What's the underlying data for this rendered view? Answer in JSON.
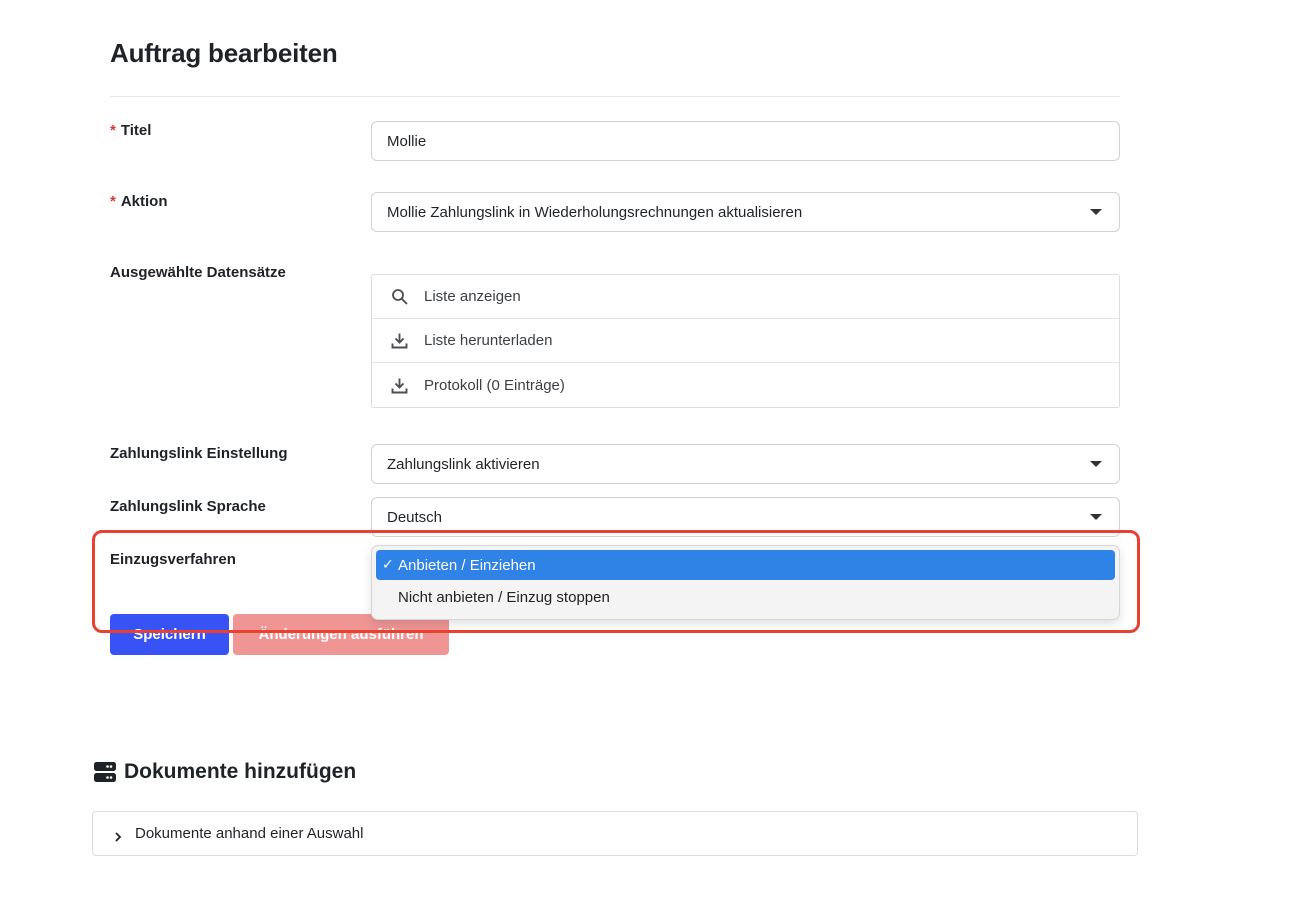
{
  "page": {
    "title": "Auftrag bearbeiten"
  },
  "form": {
    "required_marker": "*",
    "titel": {
      "label": "Titel",
      "value": "Mollie"
    },
    "aktion": {
      "label": "Aktion",
      "value": "Mollie Zahlungslink in Wiederholungsrechnungen aktualisieren"
    },
    "datensaetze": {
      "label": "Ausgewählte Datensätze",
      "items": [
        {
          "label": "Liste anzeigen",
          "icon": "search-icon"
        },
        {
          "label": "Liste herunterladen",
          "icon": "download-icon"
        },
        {
          "label": "Protokoll (0 Einträge)",
          "icon": "download-icon"
        }
      ]
    },
    "zahlungslink_einstellung": {
      "label": "Zahlungslink Einstellung",
      "value": "Zahlungslink aktivieren"
    },
    "zahlungslink_sprache": {
      "label": "Zahlungslink Sprache",
      "value": "Deutsch"
    },
    "einzugsverfahren": {
      "label": "Einzugsverfahren",
      "options": [
        {
          "label": "Anbieten / Einziehen",
          "selected": true
        },
        {
          "label": "Nicht anbieten / Einzug stoppen",
          "selected": false
        }
      ],
      "check_glyph": "✓"
    }
  },
  "buttons": {
    "save": "Speichern",
    "execute": "Änderungen ausführen"
  },
  "documents": {
    "title": "Dokumente hinzufügen",
    "accordion_label": "Dokumente anhand einer Auswahl"
  },
  "colors": {
    "primary": "#3753f5",
    "danger_disabled": "#ef9695",
    "option_selected": "#2f82e6",
    "highlight": "#e8412f",
    "required": "#d33a2f"
  }
}
